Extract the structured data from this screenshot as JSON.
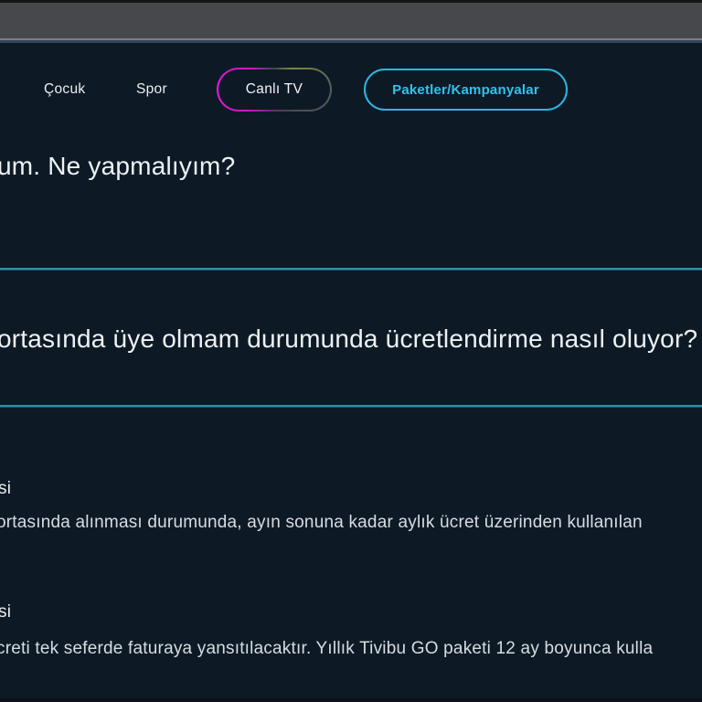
{
  "nav": {
    "items": [
      "Çocuk",
      "Spor"
    ],
    "canli_tv_label": "Canlı TV",
    "paketler_label": "Paketler/Kampanyalar"
  },
  "faq": {
    "question1": "um. Ne yapmalıyım?",
    "question2": "ortasında üye olmam durumunda ücretlendirme nasıl oluyor?",
    "section1": {
      "heading": "si",
      "body": "ortasında alınması durumunda, ayın sonuna kadar aylık ücret üzerinden kullanılan"
    },
    "section2": {
      "heading": "si",
      "body": "creti tek seferde faturaya yansıtılacaktır. Yıllık Tivibu GO paketi 12 ay boyunca kulla"
    }
  },
  "colors": {
    "page_background": "#0d1a26",
    "browser_bar": "#46484b",
    "divider_teal": "#2f8fa7",
    "cyan_accent": "#31c2ec",
    "magenta_accent": "#ef16de",
    "heading_text": "#eef1f4",
    "body_text": "#d7dce1"
  }
}
